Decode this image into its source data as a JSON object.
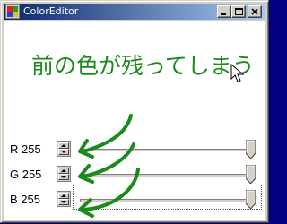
{
  "window": {
    "title": "ColorEditor",
    "buttons": [
      {
        "name": "minimize",
        "icon": "minimize-icon"
      },
      {
        "name": "maximize",
        "icon": "maximize-icon"
      },
      {
        "name": "close",
        "icon": "close-icon"
      }
    ]
  },
  "annotation": {
    "text": "前の色が残ってしまう",
    "color": "#1a8a1a"
  },
  "sliders": [
    {
      "label": "R 255",
      "value": 255,
      "max": 255
    },
    {
      "label": "G 255",
      "value": 255,
      "max": 255
    },
    {
      "label": "B 255",
      "value": 255,
      "max": 255
    }
  ],
  "colors": {
    "title_bar": "#0a246a",
    "face": "#d4d0c8",
    "annotation_green": "#1a8a1a"
  }
}
